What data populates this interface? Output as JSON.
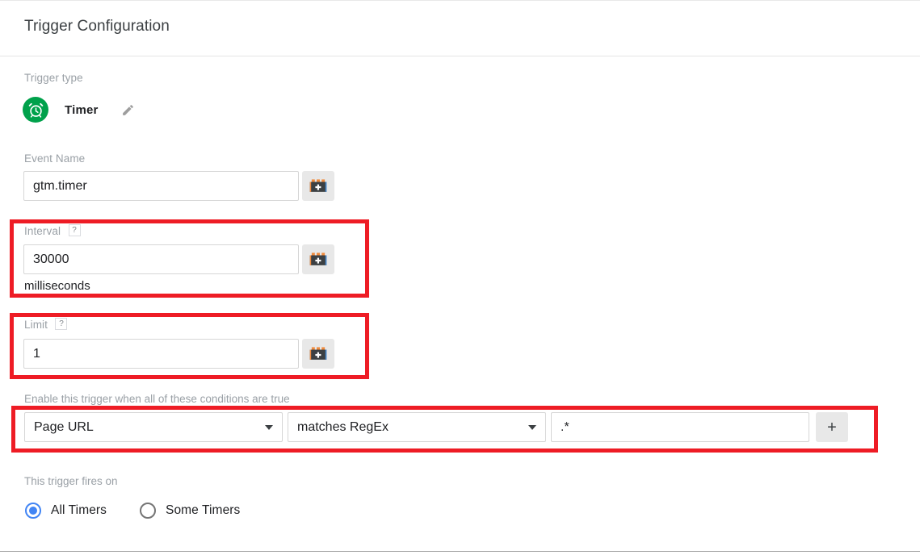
{
  "header": {
    "title": "Trigger Configuration"
  },
  "trigger_type": {
    "label": "Trigger type",
    "name": "Timer",
    "icon": "alarm-clock-icon",
    "icon_color": "#00a14b",
    "edit_icon": "pencil-icon"
  },
  "event_name": {
    "label": "Event Name",
    "value": "gtm.timer",
    "placeholder": "",
    "picker_icon": "gtm-variable-brick-icon"
  },
  "interval": {
    "label": "Interval",
    "help_icon": "?",
    "value": "30000",
    "placeholder": "",
    "units": "milliseconds",
    "picker_icon": "gtm-variable-brick-icon",
    "highlighted": true
  },
  "limit": {
    "label": "Limit",
    "help_icon": "?",
    "value": "1",
    "placeholder": "",
    "picker_icon": "gtm-variable-brick-icon",
    "highlighted": true
  },
  "conditions": {
    "label": "Enable this trigger when all of these conditions are true",
    "highlighted": true,
    "rows": [
      {
        "variable": "Page URL",
        "operator": "matches RegEx",
        "value": ".*",
        "value_placeholder": "",
        "add_label": "+"
      }
    ]
  },
  "fires_on": {
    "label": "This trigger fires on",
    "options": [
      {
        "label": "All Timers",
        "selected": true
      },
      {
        "label": "Some Timers",
        "selected": false
      }
    ]
  },
  "colors": {
    "annotation_red": "#ee1c25",
    "accent_blue": "#4285f4",
    "timer_green": "#00a14b",
    "label_gray": "#9aa0a6",
    "text_dark": "#202124"
  }
}
